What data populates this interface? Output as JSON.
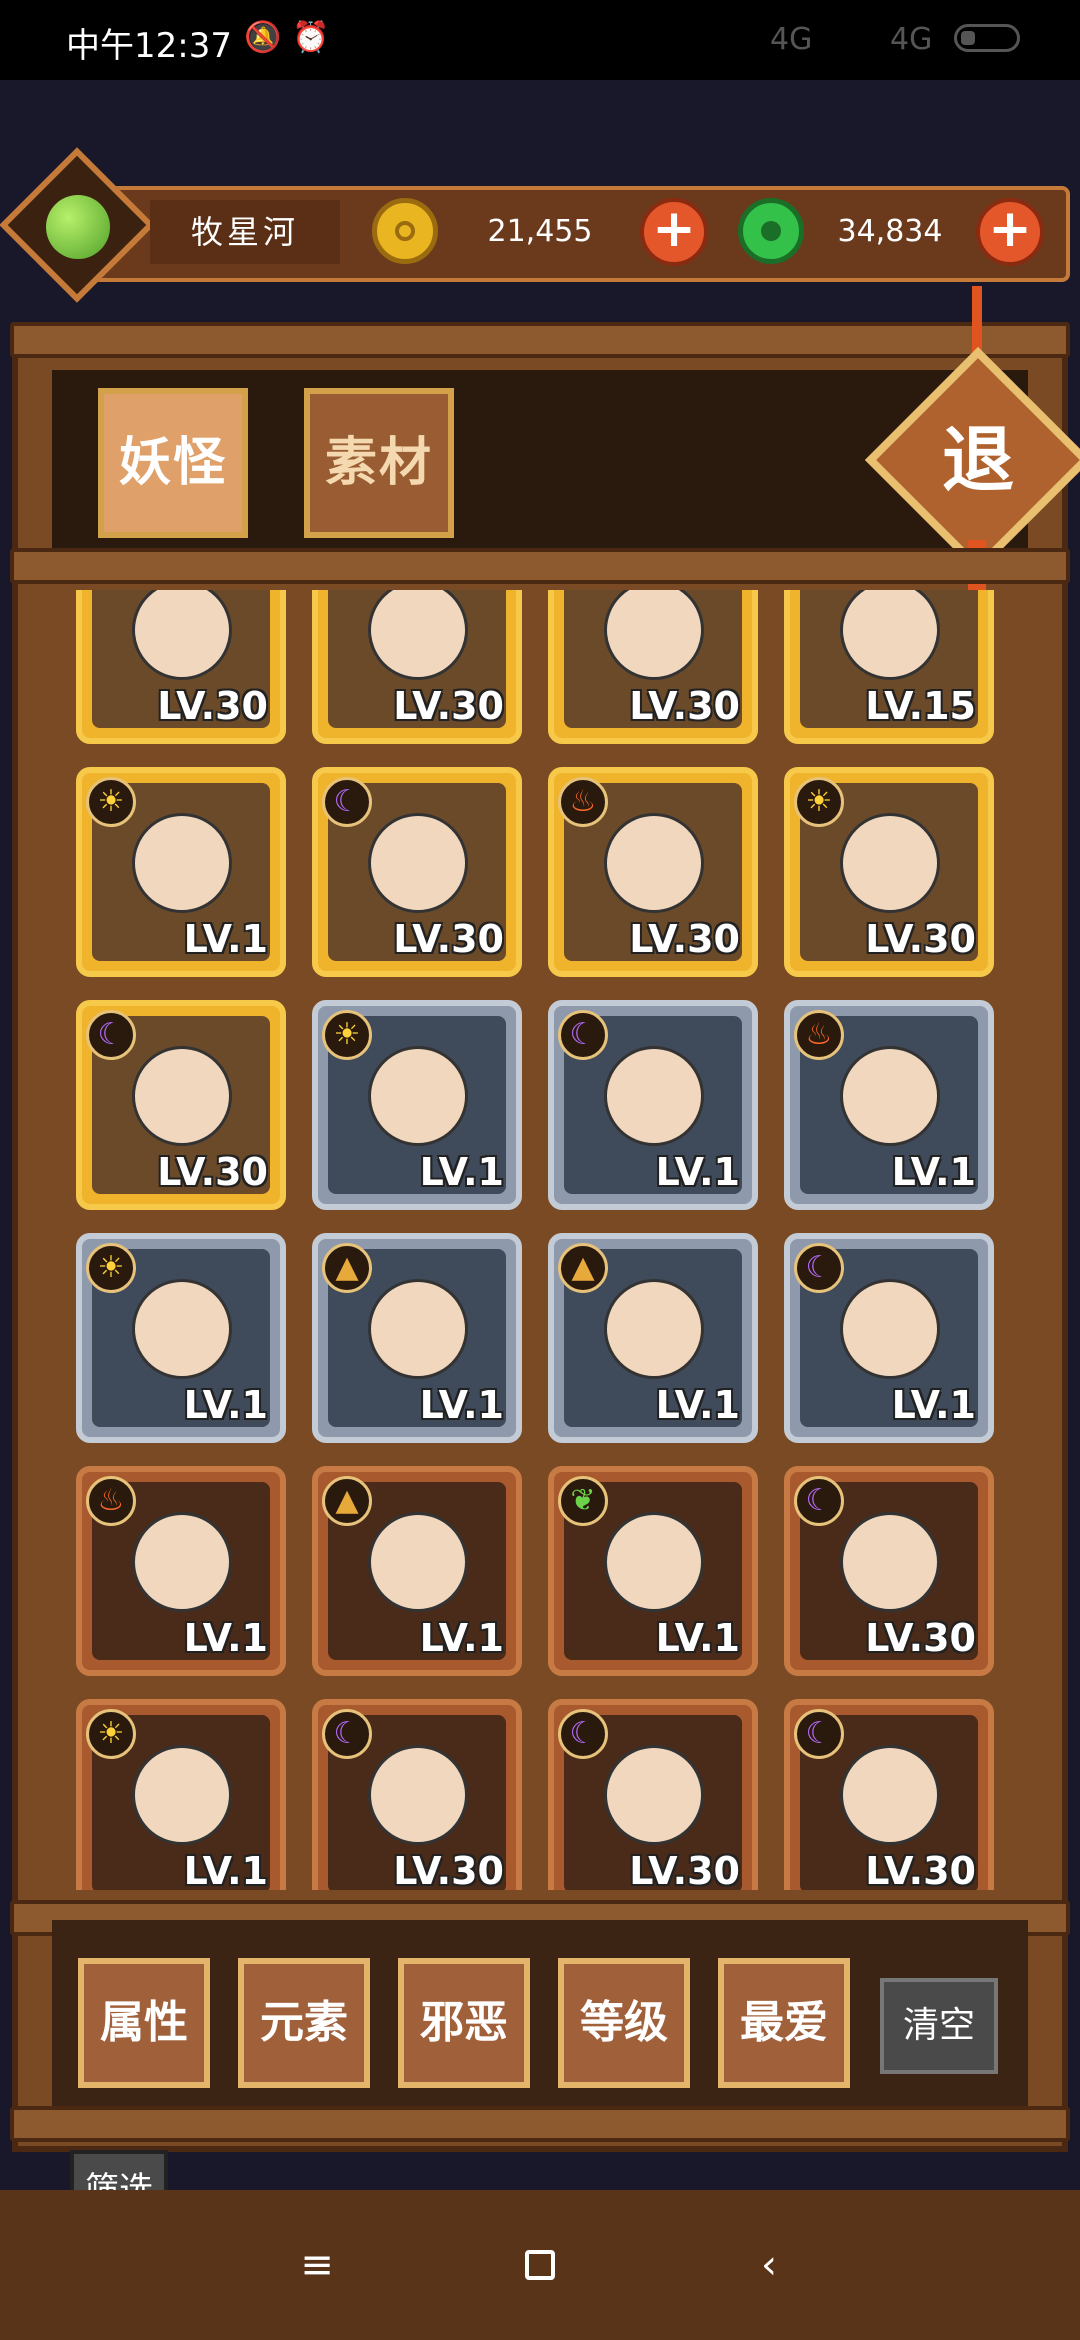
{
  "status_bar": {
    "time": "中午12:37",
    "network1": "4G",
    "network2": "4G"
  },
  "resources": {
    "player_name": "牧星河",
    "coins": "21,455",
    "jade": "34,834"
  },
  "tabs": [
    {
      "label": "妖怪",
      "active": true
    },
    {
      "label": "素材",
      "active": false
    }
  ],
  "exit_label": "退",
  "monsters": [
    {
      "level": "LV.30",
      "frame": "gold",
      "element": ""
    },
    {
      "level": "LV.30",
      "frame": "gold",
      "element": ""
    },
    {
      "level": "LV.30",
      "frame": "gold",
      "element": ""
    },
    {
      "level": "LV.15",
      "frame": "gold",
      "element": ""
    },
    {
      "level": "LV.1",
      "frame": "gold",
      "element": "sun"
    },
    {
      "level": "LV.30",
      "frame": "gold",
      "element": "moon"
    },
    {
      "level": "LV.30",
      "frame": "gold",
      "element": "fire"
    },
    {
      "level": "LV.30",
      "frame": "gold",
      "element": "sun"
    },
    {
      "level": "LV.30",
      "frame": "gold",
      "element": "moon"
    },
    {
      "level": "LV.1",
      "frame": "silver",
      "element": "sun"
    },
    {
      "level": "LV.1",
      "frame": "silver",
      "element": "moon"
    },
    {
      "level": "LV.1",
      "frame": "silver",
      "element": "fire"
    },
    {
      "level": "LV.1",
      "frame": "silver",
      "element": "sun"
    },
    {
      "level": "LV.1",
      "frame": "silver",
      "element": "earth"
    },
    {
      "level": "LV.1",
      "frame": "silver",
      "element": "earth"
    },
    {
      "level": "LV.1",
      "frame": "silver",
      "element": "moon"
    },
    {
      "level": "LV.1",
      "frame": "bronze",
      "element": "fire"
    },
    {
      "level": "LV.1",
      "frame": "bronze",
      "element": "earth"
    },
    {
      "level": "LV.1",
      "frame": "bronze",
      "element": "leaf"
    },
    {
      "level": "LV.30",
      "frame": "bronze",
      "element": "moon"
    },
    {
      "level": "LV.1",
      "frame": "bronze",
      "element": "sun"
    },
    {
      "level": "LV.30",
      "frame": "bronze",
      "element": "moon"
    },
    {
      "level": "LV.30",
      "frame": "bronze",
      "element": "moon"
    },
    {
      "level": "LV.30",
      "frame": "bronze",
      "element": "moon"
    }
  ],
  "filters": [
    "属性",
    "元素",
    "邪恶",
    "等级",
    "最爱"
  ],
  "clear_label": "清空",
  "filter_label": "筛选",
  "colors": {
    "wood": "#7a4a24",
    "gold_frame": "#f0b42c",
    "silver_frame": "#8e9aab",
    "bronze_frame": "#a85a2e",
    "accent_plus": "#e4572a"
  }
}
